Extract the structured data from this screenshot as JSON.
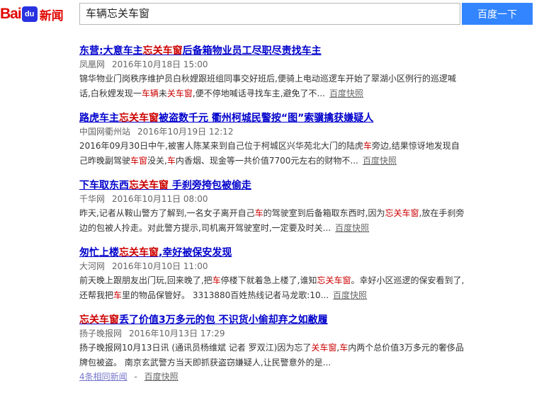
{
  "header": {
    "logo": {
      "part1": "Bai",
      "paw": "du",
      "news": "新闻"
    },
    "search": {
      "query": "车辆忘关车窗",
      "button": "百度一下"
    }
  },
  "results": [
    {
      "title": [
        {
          "t": "东营:大意车主"
        },
        {
          "t": "忘关车窗",
          "hl": true
        },
        {
          "t": "后备箱物业员工尽职尽责找车主"
        }
      ],
      "source": "凤凰网",
      "time": "2016年10月18日 15:00",
      "summary": [
        {
          "t": "锦华物业门岗秩序维护员白秋娌跟班组同事交好班后,便骑上电动巡逻车开始了翠湖小区例行的巡逻喊话,白秋娌发现一"
        },
        {
          "t": "车辆",
          "hl": true
        },
        {
          "t": "未"
        },
        {
          "t": "关车窗",
          "hl": true
        },
        {
          "t": ",便不停地喊话寻找车主,避免了不..."
        }
      ],
      "snapshot": "百度快照"
    },
    {
      "title": [
        {
          "t": "路虎车主"
        },
        {
          "t": "忘关车窗",
          "hl": true
        },
        {
          "t": "被盗数千元 衢州柯城民警按“图”索骥擒获嫌疑人"
        }
      ],
      "source": "中国网衢州站",
      "time": "2016年10月19日 12:12",
      "summary": [
        {
          "t": "2016年09月30日中午,被害人陈某来到自己位于柯城区兴华苑北大门的陆虎"
        },
        {
          "t": "车",
          "hl": true
        },
        {
          "t": "旁边,结果惊讶地发现自己昨晚副驾驶"
        },
        {
          "t": "车窗",
          "hl": true
        },
        {
          "t": "没关,"
        },
        {
          "t": "车",
          "hl": true
        },
        {
          "t": "内香烟、现金等一共价值7700元左右的财物不..."
        }
      ],
      "snapshot": "百度快照"
    },
    {
      "title": [
        {
          "t": "下车取东西"
        },
        {
          "t": "忘关车窗",
          "hl": true
        },
        {
          "t": " 手刹旁挎包被偷走"
        }
      ],
      "source": "千华网",
      "time": "2016年10月11日 08:00",
      "summary": [
        {
          "t": "昨天,记者从鞍山警方了解到,一名女子离开自己"
        },
        {
          "t": "车",
          "hl": true
        },
        {
          "t": "的驾驶室到后备箱取东西时,因为"
        },
        {
          "t": "忘关车窗",
          "hl": true
        },
        {
          "t": ",放在手刹旁边的包被人拎走。对此警方提示,司机离开驾驶室时,一定要及时关..."
        }
      ],
      "snapshot": "百度快照"
    },
    {
      "title": [
        {
          "t": "匆忙上楼"
        },
        {
          "t": "忘关车窗",
          "hl": true
        },
        {
          "t": ",幸好被保安发现"
        }
      ],
      "source": "大河网",
      "time": "2016年10月10日 11:00",
      "summary": [
        {
          "t": "前天晚上跟朋友出门玩,回来晚了,把"
        },
        {
          "t": "车",
          "hl": true
        },
        {
          "t": "停楼下就着急上楼了,谁知"
        },
        {
          "t": "忘关车窗",
          "hl": true
        },
        {
          "t": "。幸好小区巡逻的保安看到了,还帮我把"
        },
        {
          "t": "车",
          "hl": true
        },
        {
          "t": "里的物品保管好。 3313880百姓热线记者马龙歌:10..."
        }
      ],
      "snapshot": "百度快照"
    },
    {
      "title": [
        {
          "t": "忘关车窗",
          "hl": true
        },
        {
          "t": "丢了价值3万多元的包 不识货小偷却弃之如敝履"
        }
      ],
      "source": "扬子晚报网",
      "time": "2016年10月13日 17:29",
      "summary": [
        {
          "t": "扬子晚报网10月13日讯 (通讯员杨维斌 记者 罗双江)因为忘了"
        },
        {
          "t": "关车窗",
          "hl": true
        },
        {
          "t": ","
        },
        {
          "t": "车",
          "hl": true
        },
        {
          "t": "内两个总价值3万多元的奢侈品牌包被盗。 南京玄武警方当天即抓获盗窃嫌疑人,让民警意外的是..."
        }
      ],
      "snapshot": "",
      "related": "4条相同新闻",
      "related_sep": "-",
      "related_snapshot": "百度快照"
    }
  ]
}
